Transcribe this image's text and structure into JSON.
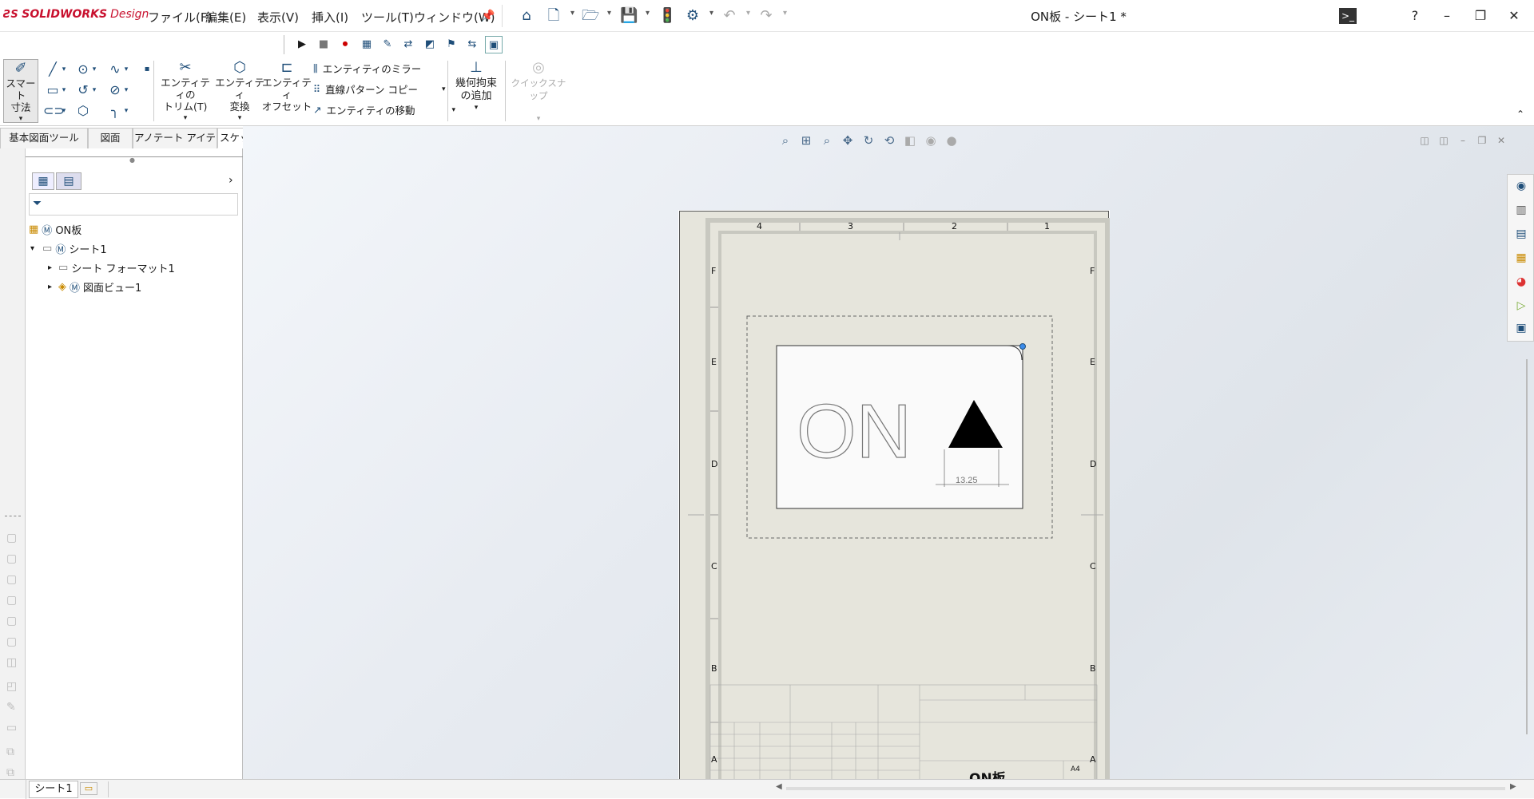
{
  "app": {
    "logo_brand": "SOLIDWORKS",
    "logo_edition": "Design",
    "document_title": "ON板 - シート1 *"
  },
  "menu": {
    "items": [
      "ファイル(F)",
      "編集(E)",
      "表示(V)",
      "挿入(I)",
      "ツール(T)",
      "ウィンドウ(W)"
    ]
  },
  "ribbon": {
    "smart_dimension": "スマート\n寸法",
    "trim": "エンティティの\nトリム(T)",
    "convert": "エンティティ\n変換",
    "offset": "エンティティ\nオフセット",
    "mirror": "エンティティのミラー",
    "linear_pattern": "直線パターン コピー",
    "move": "エンティティの移動",
    "add_relation": "幾何拘束\nの追加",
    "quick_snap": "クイックスナップ"
  },
  "tabs": {
    "items": [
      "基本図面ツール",
      "図面",
      "アノテート アイテム",
      "スケッチ"
    ],
    "active": "スケッチ"
  },
  "tree": {
    "root": "ON板",
    "sheet": "シート1",
    "sheet_format": "シート フォーマット1",
    "drawing_view": "図面ビュー1"
  },
  "drawing": {
    "columns": [
      "4",
      "3",
      "2",
      "1"
    ],
    "rows": [
      "F",
      "E",
      "D",
      "C",
      "B",
      "A"
    ],
    "part_text": "ON",
    "dimension": "13.25",
    "title_name": "ON板",
    "paper_size": "A4"
  },
  "status": {
    "sheet_tab": "シート1"
  },
  "colors": {
    "brand_red": "#c8102e",
    "icon_blue": "#1f4e79",
    "sheet_bg": "#e6e5dc"
  }
}
